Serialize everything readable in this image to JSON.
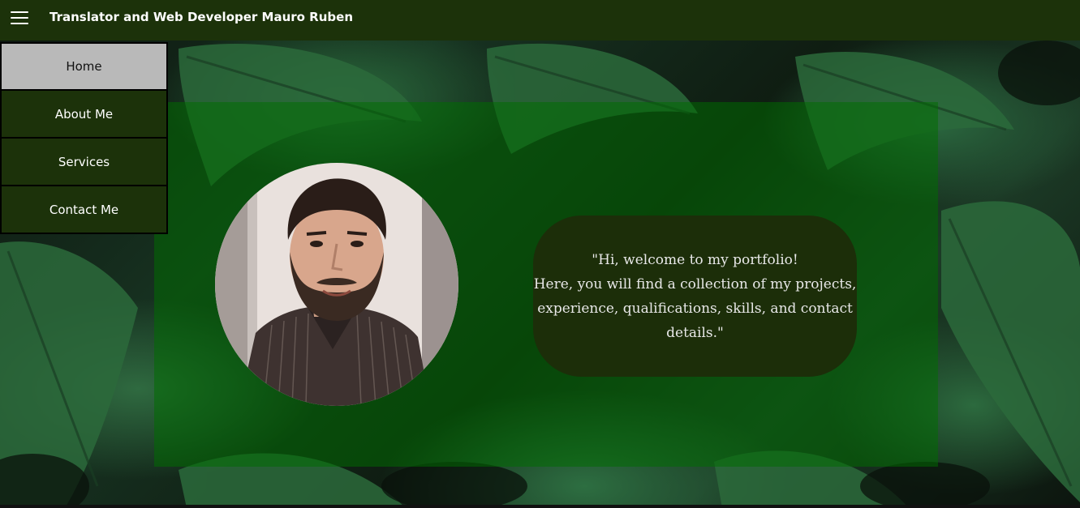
{
  "header": {
    "menu_icon": "hamburger-menu-icon",
    "title": "Translator and Web Developer Mauro Ruben",
    "background_color": "#1c320a"
  },
  "side_menu": {
    "items": [
      {
        "label": "Home",
        "active": true
      },
      {
        "label": "About Me",
        "active": false
      },
      {
        "label": "Services",
        "active": false
      },
      {
        "label": "Contact Me",
        "active": false
      }
    ],
    "active_color": "#b9b9b9",
    "item_color": "#1c320a"
  },
  "hero": {
    "panel_color": "rgba(0,110,0,0.52)",
    "profile_photo": "profile-photo",
    "welcome_lines": [
      "\"Hi, welcome to my portfolio!",
      "Here, you will find a collection of my projects,",
      "experience, qualifications, skills, and contact",
      "details.\""
    ],
    "welcome_box_color": "#1c2e09"
  },
  "background": {
    "image": "monstera-leaves-background"
  }
}
